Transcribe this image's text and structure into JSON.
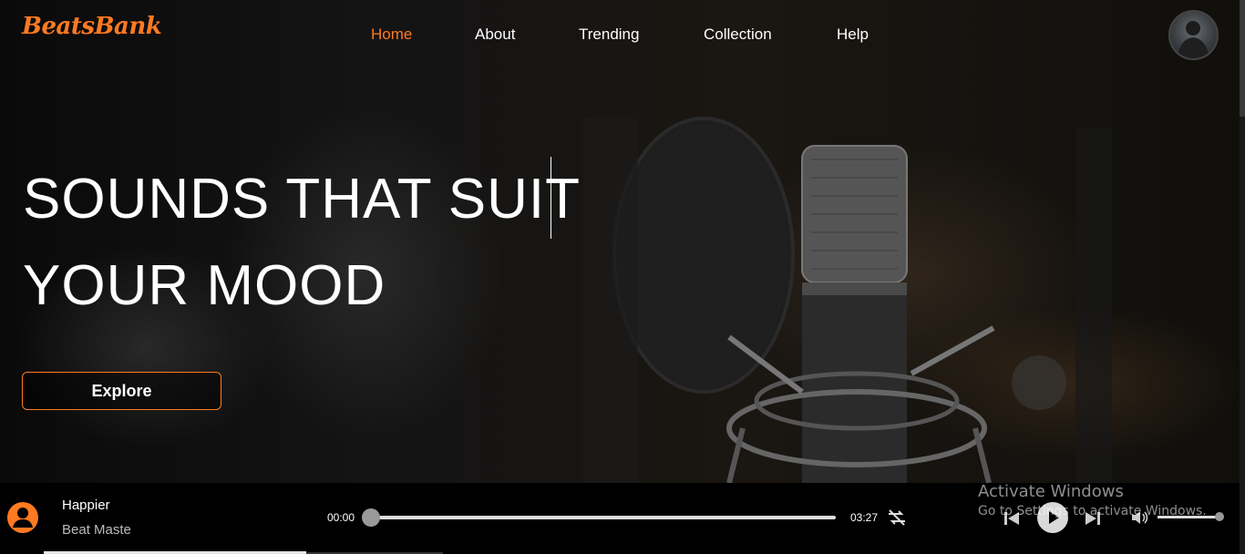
{
  "header": {
    "logo": "BeatsBank",
    "nav": [
      {
        "label": "Home",
        "active": true
      },
      {
        "label": "About",
        "active": false
      },
      {
        "label": "Trending",
        "active": false
      },
      {
        "label": "Collection",
        "active": false
      },
      {
        "label": "Help",
        "active": false
      }
    ],
    "avatar_icon": "user-avatar-photo"
  },
  "hero": {
    "line1": "SOUNDS THAT SUIT",
    "line2": "YOUR MOOD",
    "cta_label": "Explore"
  },
  "player": {
    "track_title": "Happier",
    "track_artist": "Beat Maste",
    "current_time": "00:00",
    "total_time": "03:27",
    "progress": 0.0,
    "volume": 1.0,
    "icons": [
      "user-circle-icon",
      "loop-icon",
      "previous-icon",
      "play-icon",
      "next-icon",
      "volume-icon"
    ]
  },
  "watermark": {
    "line1": "Activate Windows",
    "line2": "Go to Settings to activate Windows."
  },
  "colors": {
    "accent": "#ff7a21",
    "background": "#000000",
    "text": "#ffffff"
  }
}
